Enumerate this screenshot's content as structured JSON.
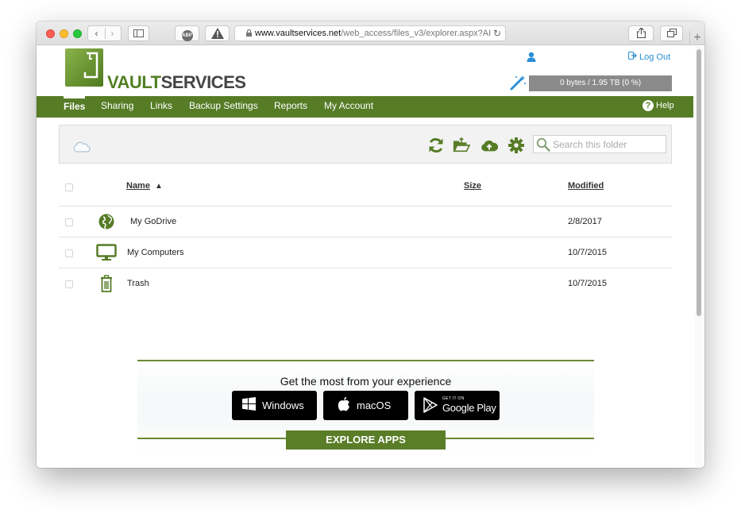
{
  "browser": {
    "url_host": "www.vaultservices.net",
    "url_path": "/web_access/files_v3/explorer.aspx?AI"
  },
  "brand": {
    "logo_part1": "VAULT",
    "logo_part2": "SERVICES",
    "accent": "#567c26",
    "link_color": "#2a8fd6"
  },
  "header": {
    "logout_label": "Log Out",
    "quota_text": "0 bytes / 1.95 TB (0 %)"
  },
  "nav": {
    "items": [
      {
        "label": "Files",
        "active": true
      },
      {
        "label": "Sharing"
      },
      {
        "label": "Links"
      },
      {
        "label": "Backup Settings"
      },
      {
        "label": "Reports"
      },
      {
        "label": "My Account"
      }
    ],
    "help_label": "Help"
  },
  "toolbar": {
    "icons": [
      "cloud-icon",
      "refresh-icon",
      "folder-open-icon",
      "cloud-upload-icon",
      "gear-icon",
      "search-icon"
    ],
    "search_placeholder": "Search this folder"
  },
  "table": {
    "columns": {
      "name": "Name",
      "size": "Size",
      "modified": "Modified"
    },
    "rows": [
      {
        "icon": "globe-icon",
        "name": "My GoDrive",
        "size": "",
        "modified": "2/8/2017"
      },
      {
        "icon": "monitor-icon",
        "name": "My Computers",
        "size": "",
        "modified": "10/7/2015"
      },
      {
        "icon": "trash-icon",
        "name": "Trash",
        "size": "",
        "modified": "10/7/2015"
      }
    ]
  },
  "promo": {
    "title": "Get the most from your experience",
    "windows_label": "Windows",
    "macos_label": "macOS",
    "gp_small": "GET IT ON",
    "gp_big": "Google Play",
    "explore_label": "EXPLORE APPS"
  }
}
